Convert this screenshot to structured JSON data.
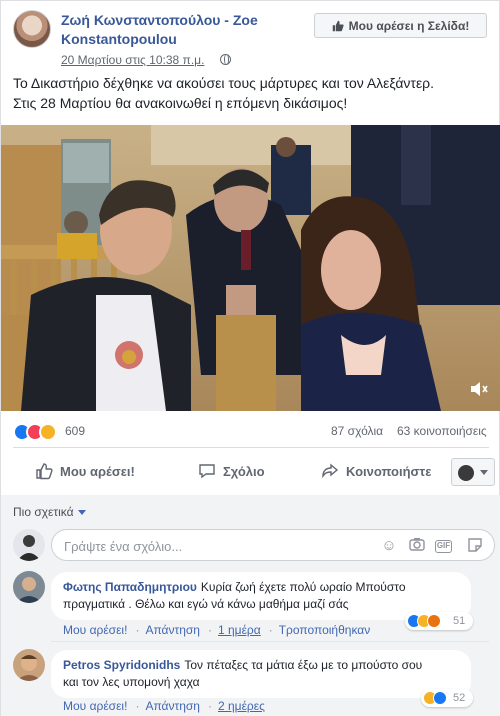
{
  "page": {
    "name": "Ζωή Κωνσταντοπούλου - Zoe Konstantopoulou",
    "like_button": "Μου αρέσει η Σελίδα!",
    "time": "20 Μαρτίου στις 10:38 π.μ."
  },
  "post": {
    "line1": "Το Δικαστήριο δέχθηκε να ακούσει τους μάρτυρες και τον Αλεξάντερ.",
    "line2": "Στις 28 Μαρτίου θα ανακοινωθεί η επόμενη δικάσιμος!"
  },
  "stats": {
    "reactions": "609",
    "comments": "87 σχόλια",
    "shares": "63 κοινοποιήσεις"
  },
  "actions": {
    "like": "Μου αρέσει!",
    "comment": "Σχόλιο",
    "share": "Κοινοποιήστε"
  },
  "comments_section": {
    "sort": "Πιο σχετικά",
    "placeholder": "Γράψτε ένα σχόλιο..."
  },
  "comments": [
    {
      "author": "Φωτης Παπαδημητριου",
      "text_line1": "Κυρία ζωή έχετε πολύ ωραίο Μπούστο",
      "text_line2": "πραγματικά . Θέλω και εγώ νά κάνω μαθήμα μαζί σάς",
      "like": "Μου αρέσει!",
      "reply": "Απάντηση",
      "time": "1 ημέρα",
      "translated": "Τροποποιήθηκαν",
      "reactions": "51"
    },
    {
      "author": "Petros Spyridonidhs",
      "text_line1": "Τον πέταξες τα μάτια έξω με το μπούστο σου",
      "text_line2": "και τον λες υπομονή χαχα",
      "like": "Μου αρέσει!",
      "reply": "Απάντηση",
      "time": "2 ημέρες",
      "reactions": "52"
    }
  ],
  "colors": {
    "link": "#385898",
    "like_blue": "#1877f2",
    "love_red": "#f33e58",
    "haha_yellow": "#f7b125"
  }
}
